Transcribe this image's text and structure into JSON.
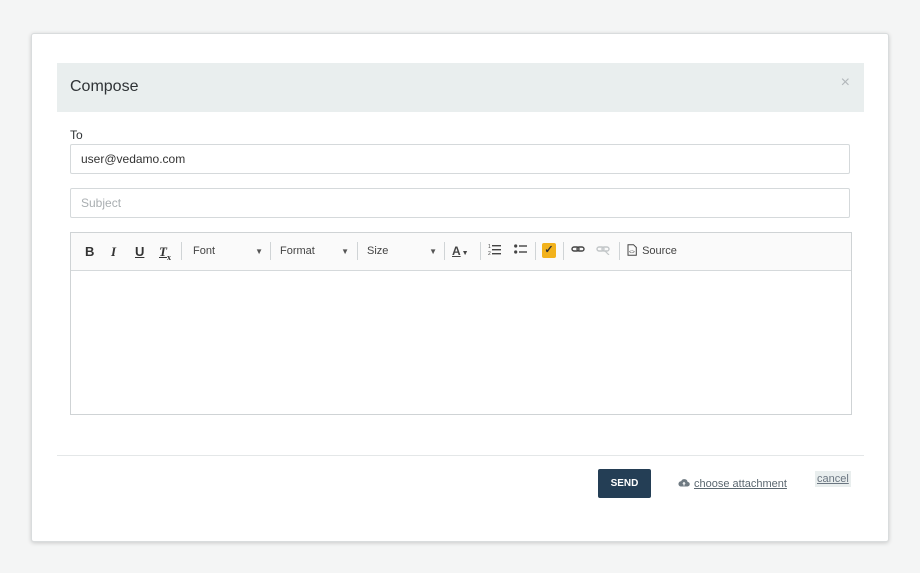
{
  "dialog": {
    "title": "Compose",
    "close_glyph": "×"
  },
  "form": {
    "to_label": "To",
    "to_value": "user@vedamo.com",
    "subject_placeholder": "Subject"
  },
  "toolbar": {
    "bold": "B",
    "italic": "I",
    "underline": "U",
    "remove_format": "T",
    "font": "Font",
    "format": "Format",
    "size": "Size",
    "text_color": "A",
    "spellcheck": "✓",
    "source": "Source"
  },
  "footer": {
    "send_label": "SEND",
    "attach_label": "choose attachment",
    "cancel_label": "cancel"
  },
  "colors": {
    "header_bg": "#e9eeee",
    "send_bg": "#243e55",
    "spellcheck": "#f2b21c"
  }
}
